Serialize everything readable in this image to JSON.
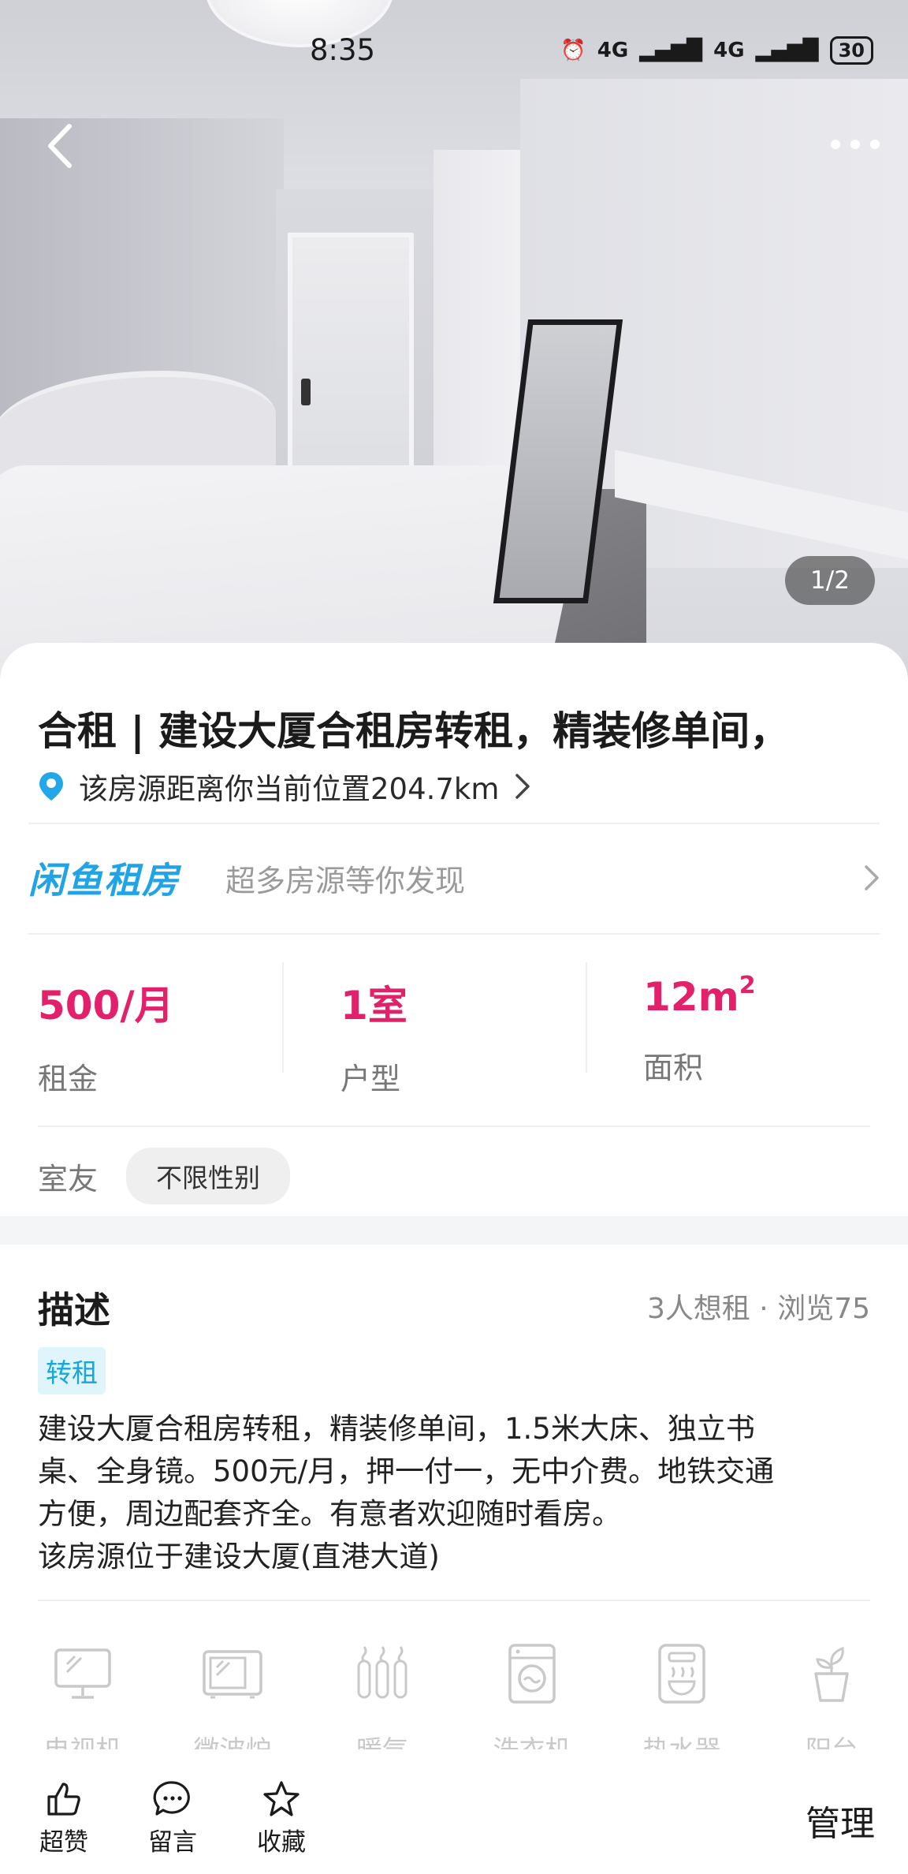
{
  "status_bar": {
    "time": "8:35",
    "signal1": "4G",
    "signal2": "4G",
    "battery": "30"
  },
  "photo": {
    "counter": "1/2"
  },
  "listing": {
    "title": "合租 | 建设大厦合租房转租，精装修单间，",
    "location_text": "该房源距离你当前位置204.7km"
  },
  "brand": {
    "logo": "闲鱼租房",
    "slogan": "超多房源等你发现"
  },
  "stats": [
    {
      "value": "500/月",
      "label": "租金"
    },
    {
      "value": "1室",
      "label": "户型"
    },
    {
      "value": "12m",
      "sup": "2",
      "label": "面积"
    }
  ],
  "roommate": {
    "label": "室友",
    "value": "不限性别"
  },
  "description": {
    "title": "描述",
    "meta": "3人想租 · 浏览75",
    "tag": "转租",
    "lines": [
      "建设大厦合租房转租，精装修单间，1.5米大床、独立书",
      "桌、全身镜。500元/月，押一付一，无中介费。地铁交通",
      "方便，周边配套齐全。有意者欢迎随时看房。",
      "该房源位于建设大厦(直港大道)"
    ]
  },
  "amenities": [
    {
      "label": "电视机",
      "icon": "tv-icon"
    },
    {
      "label": "微波炉",
      "icon": "microwave-icon"
    },
    {
      "label": "暖气",
      "icon": "radiator-icon"
    },
    {
      "label": "洗衣机",
      "icon": "washing-machine-icon"
    },
    {
      "label": "热水器",
      "icon": "water-heater-icon"
    },
    {
      "label": "阳台",
      "icon": "balcony-plant-icon"
    }
  ],
  "bottom_bar": {
    "like": "超赞",
    "comment": "留言",
    "favorite": "收藏",
    "manage": "管理"
  },
  "colors": {
    "accent_price": "#e3216b",
    "brand_blue": "#20a4e6",
    "tag_bg": "#dff4fb"
  }
}
